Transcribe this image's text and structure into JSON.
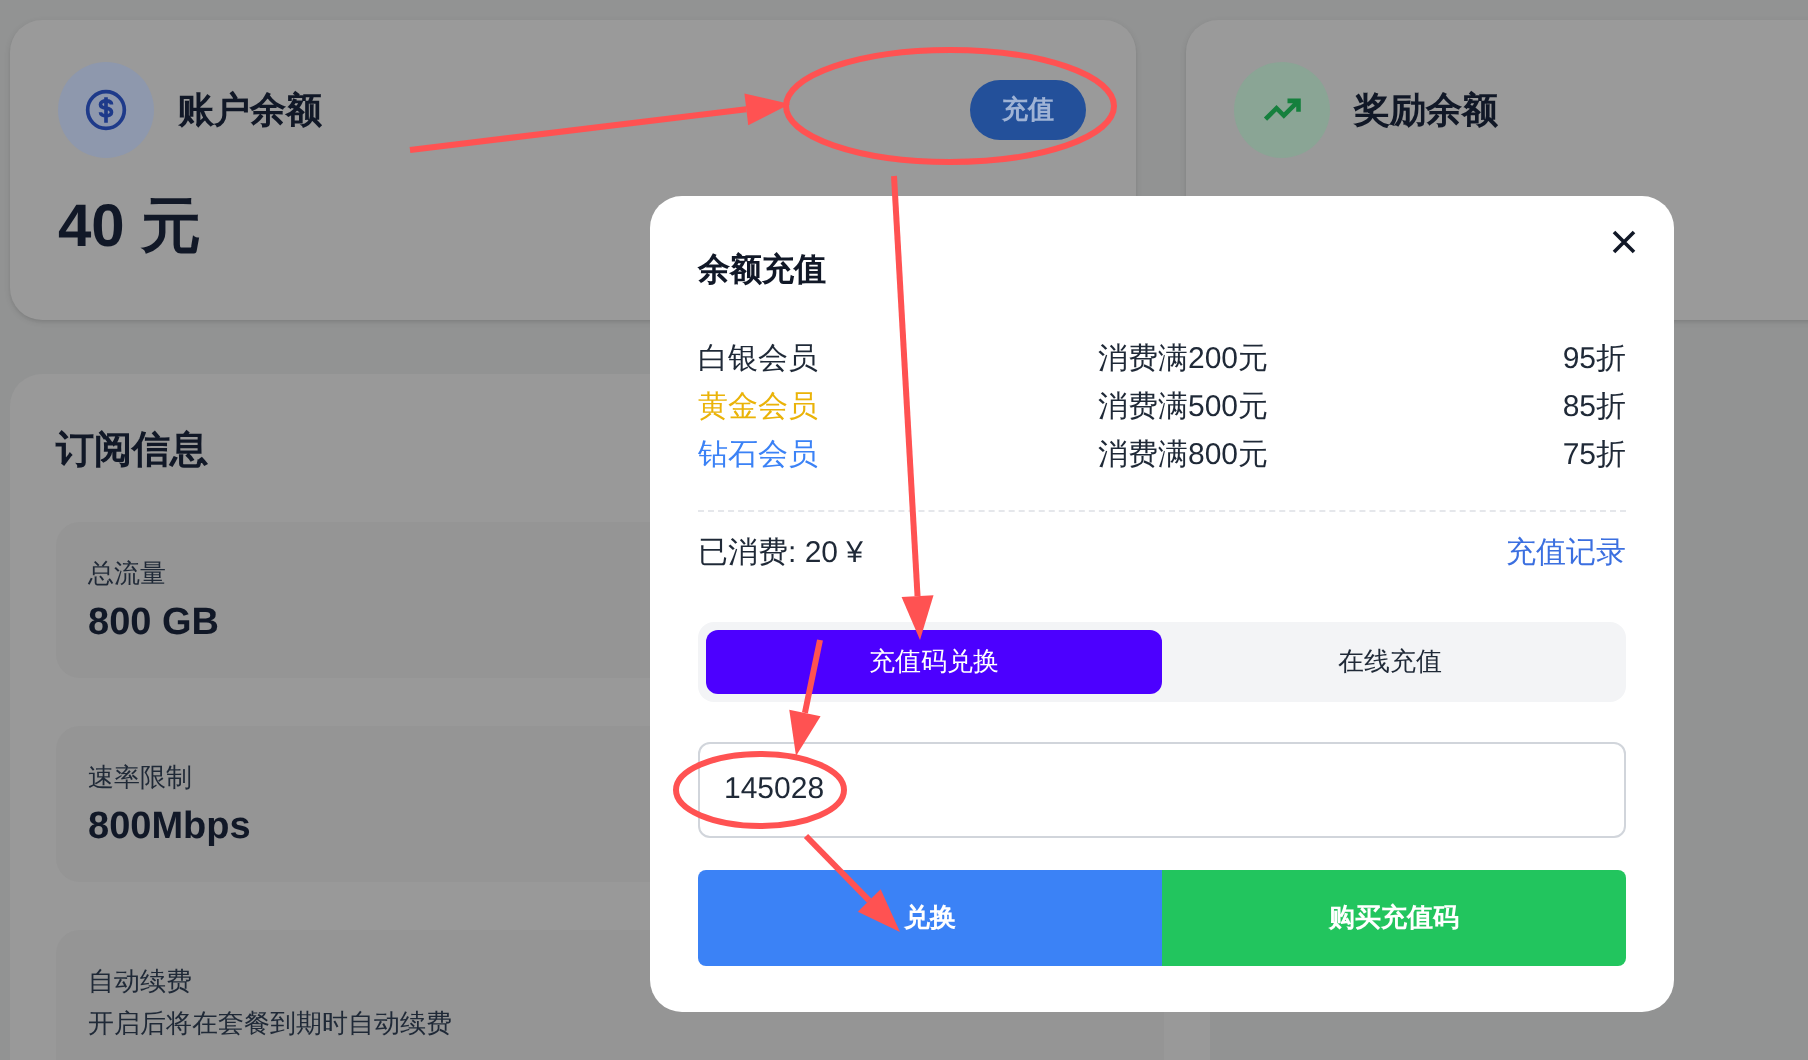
{
  "balance_card": {
    "title": "账户余额",
    "amount": "40 元",
    "button": "充值"
  },
  "reward_card": {
    "title": "奖励余额"
  },
  "subscription": {
    "title": "订阅信息",
    "items": [
      {
        "kind": "stat",
        "label": "总流量",
        "value": "800 GB"
      },
      {
        "kind": "stat",
        "label": "速率限制",
        "value": "800Mbps"
      },
      {
        "kind": "note",
        "label": "自动续费",
        "value": "开启后将在套餐到期时自动续费"
      }
    ]
  },
  "dialog": {
    "title": "余额充值",
    "tiers": [
      {
        "name": "白银会员",
        "color": "#1f2937",
        "threshold": "消费满200元",
        "discount": "95折"
      },
      {
        "name": "黄金会员",
        "color": "#eab308",
        "threshold": "消费满500元",
        "discount": "85折"
      },
      {
        "name": "钻石会员",
        "color": "#3b82f6",
        "threshold": "消费满800元",
        "discount": "75折"
      }
    ],
    "spent": "已消费: 20 ¥",
    "history_link": "充值记录",
    "tabs": [
      {
        "label": "充值码兑换",
        "selected": true
      },
      {
        "label": "在线充值",
        "selected": false
      }
    ],
    "code_input": {
      "value": "145028"
    },
    "buttons": [
      {
        "label": "兑换",
        "kind": "primary"
      },
      {
        "label": "购买充值码",
        "kind": "success"
      }
    ]
  }
}
